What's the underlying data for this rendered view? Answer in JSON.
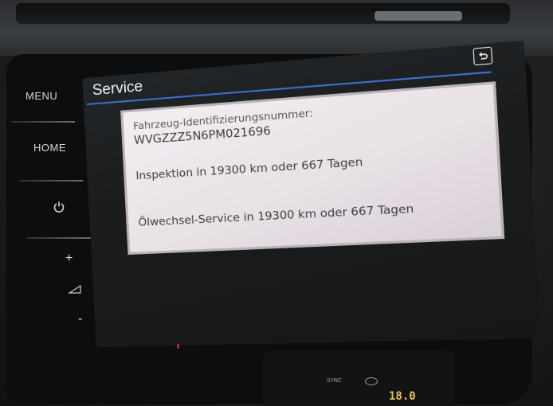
{
  "hardware_buttons": {
    "menu": "MENU",
    "home": "HOME",
    "power_icon": "power-icon",
    "volume_up": "+",
    "volume_down": "-"
  },
  "screen": {
    "title": "Service",
    "back_icon": "back-return-icon",
    "accent_color": "#3b6fd0"
  },
  "popup": {
    "vin_label": "Fahrzeug-Identifizierungsnummer:",
    "vin_value": "WVGZZZ5N6PM021696",
    "inspection": "Inspektion in 19300 km oder 667 Tagen",
    "oil_service": "Ölwechsel-Service in 19300 km oder 667 Tagen"
  },
  "climate": {
    "sync_label": "SYNC",
    "temperature": "18.0"
  }
}
